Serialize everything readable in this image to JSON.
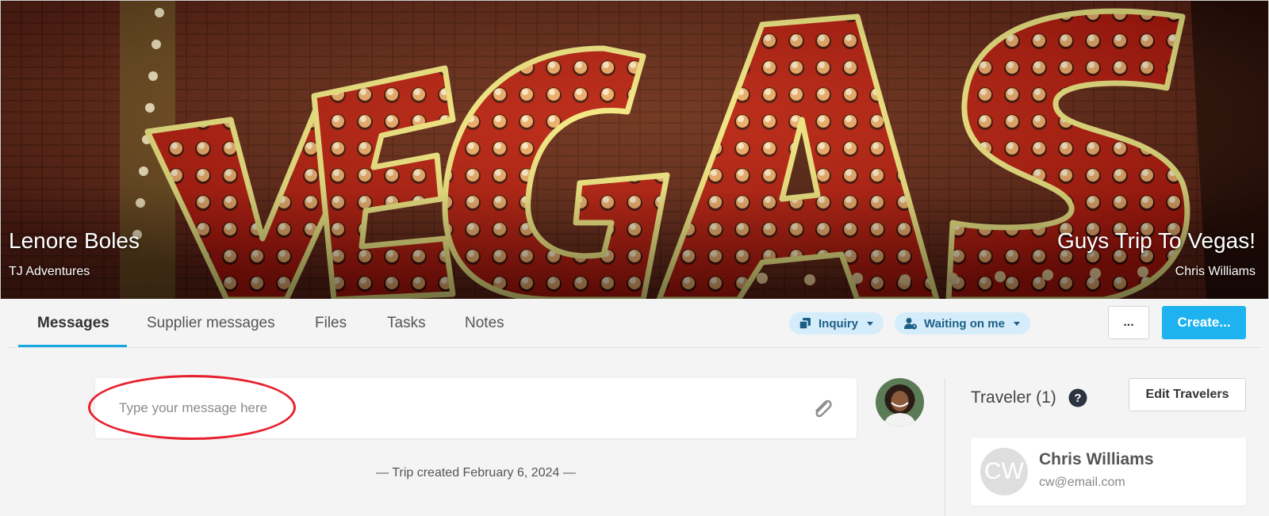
{
  "hero": {
    "client_name": "Lenore Boles",
    "agency": "TJ Adventures",
    "trip_title": "Guys Trip To Vegas!",
    "trip_owner": "Chris Williams",
    "image_sign_text": "VEGAS"
  },
  "tabs": [
    {
      "label": "Messages",
      "active": true
    },
    {
      "label": "Supplier messages",
      "active": false
    },
    {
      "label": "Files",
      "active": false
    },
    {
      "label": "Tasks",
      "active": false
    },
    {
      "label": "Notes",
      "active": false
    }
  ],
  "status_pills": {
    "stage": {
      "label": "Inquiry",
      "icon": "copy-icon"
    },
    "waiting": {
      "label": "Waiting on me",
      "icon": "user-clock-icon"
    }
  },
  "actions": {
    "more_label": "...",
    "create_label": "Create..."
  },
  "composer": {
    "placeholder": "Type your message here",
    "value": "",
    "attach_icon": "paperclip-icon"
  },
  "timeline": {
    "trip_created": "— Trip created February 6, 2024 —"
  },
  "travelers": {
    "title": "Traveler (1)",
    "edit_label": "Edit Travelers",
    "items": [
      {
        "initials": "CW",
        "name": "Chris Williams",
        "email": "cw@email.com"
      }
    ]
  },
  "colors": {
    "accent": "#1fb2f0",
    "pill_bg": "#d5ecfa",
    "pill_text": "#1c5f86",
    "annotation": "#e8202e"
  }
}
